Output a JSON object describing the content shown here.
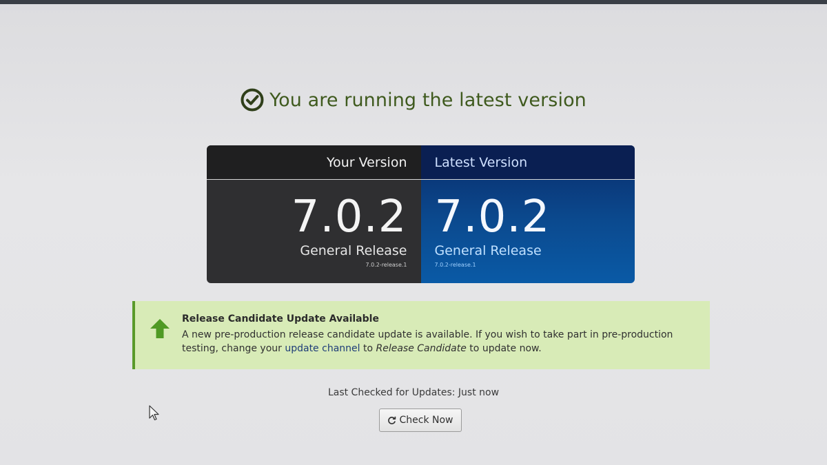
{
  "header": {
    "title": "You are running the latest version",
    "icon": "check-circle-icon",
    "color": "#3f5a1e"
  },
  "versions": {
    "yours": {
      "label": "Your Version",
      "number": "7.0.2",
      "release": "General Release",
      "build": "7.0.2-release.1"
    },
    "latest": {
      "label": "Latest Version",
      "number": "7.0.2",
      "release": "General Release",
      "build": "7.0.2-release.1"
    },
    "colors": {
      "yours_bg": "#2f2f31",
      "latest_bg": "#0b4a8f"
    }
  },
  "notice": {
    "icon": "arrow-up-icon",
    "title": "Release Candidate Update Available",
    "body_start": "A new pre-production release candidate update is available. If you wish to take part in pre-production testing, change your ",
    "link_text": "update channel",
    "body_mid": " to ",
    "channel_name": "Release Candidate",
    "body_end": " to update now.",
    "colors": {
      "background": "#d8ebb7",
      "accent": "#5a9a2a"
    }
  },
  "footer": {
    "last_checked": "Last Checked for Updates: Just now",
    "check_button": "Check Now",
    "check_icon": "refresh-icon"
  }
}
